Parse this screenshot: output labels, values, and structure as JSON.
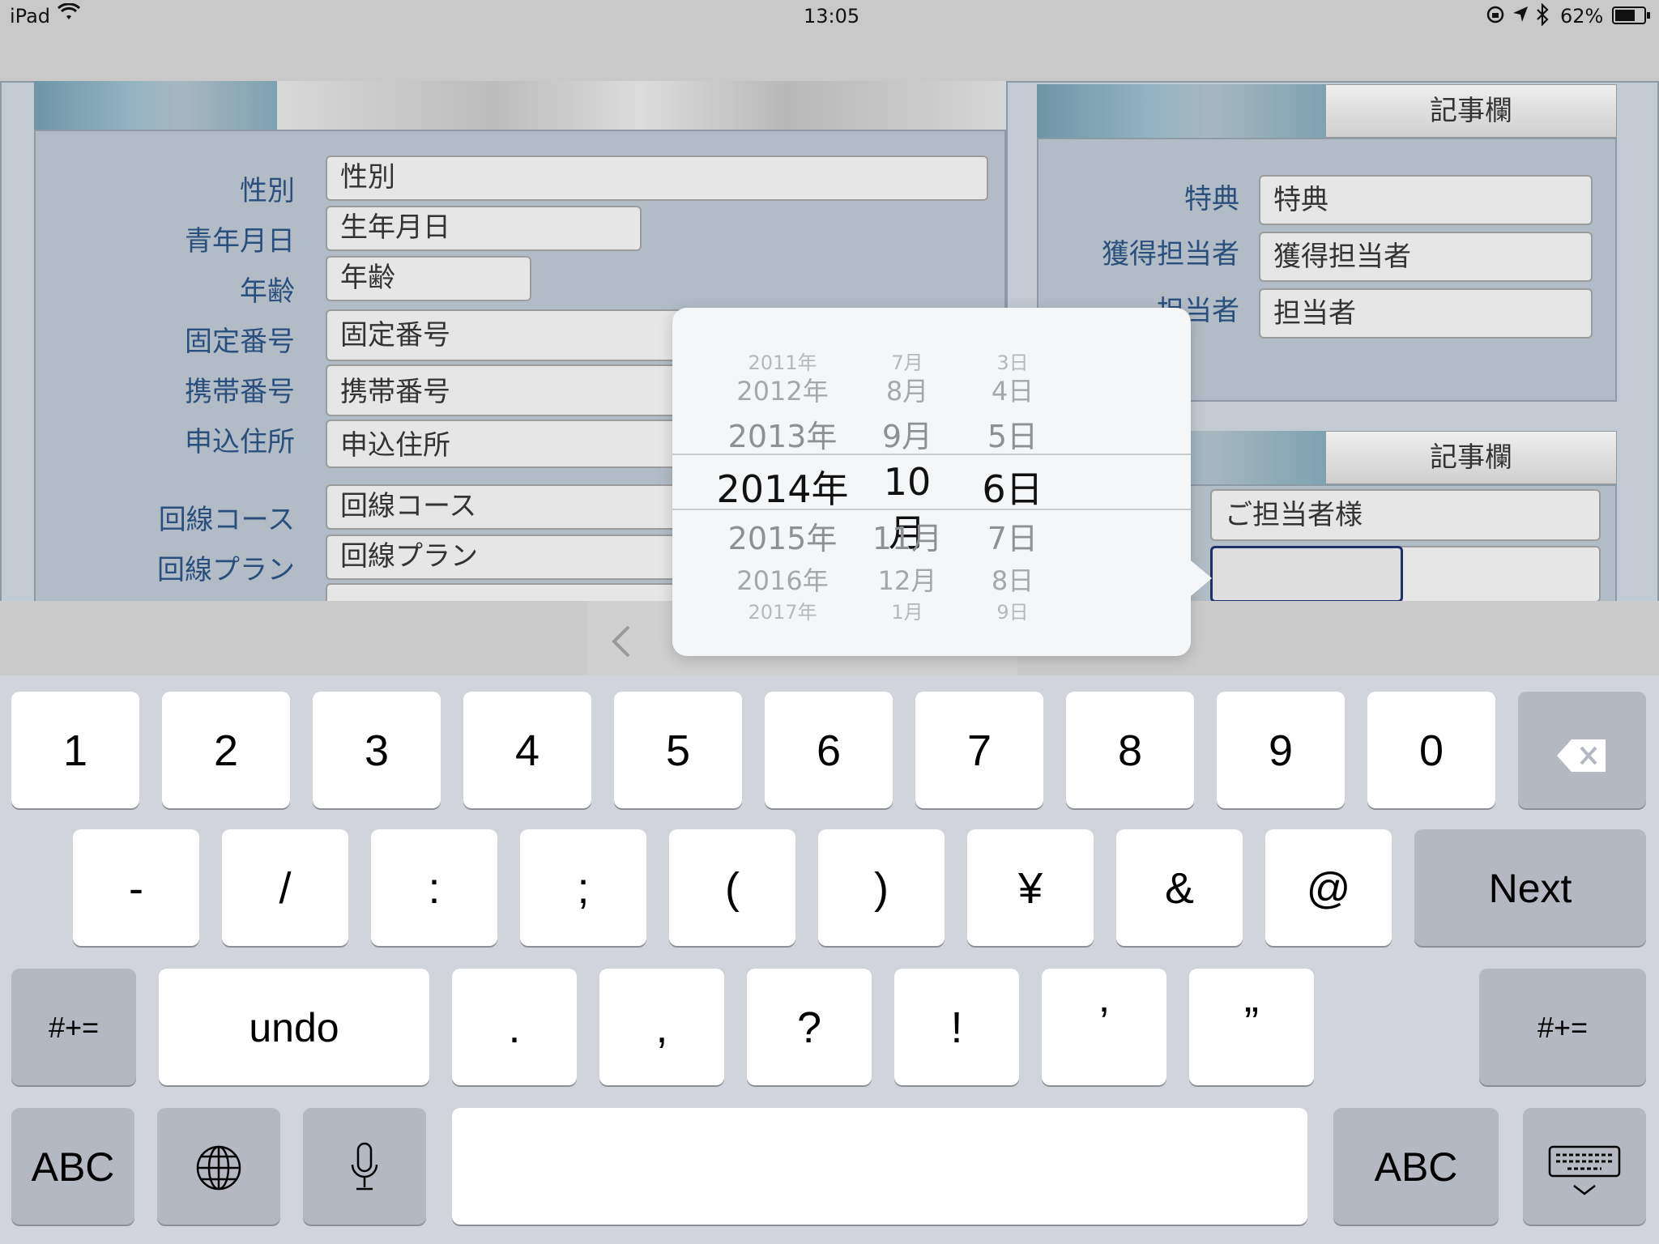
{
  "status_bar": {
    "device": "iPad",
    "time": "13:05",
    "battery": "62%"
  },
  "form_left": {
    "fields": [
      {
        "label": "性別",
        "value": "性別"
      },
      {
        "label": "青年月日",
        "value": "生年月日"
      },
      {
        "label": "年齢",
        "value": "年齢"
      },
      {
        "label": "固定番号",
        "value": "固定番号"
      },
      {
        "label": "携帯番号",
        "value": "携帯番号"
      },
      {
        "label": "申込住所",
        "value": "申込住所"
      },
      {
        "label": "回線コース",
        "value": "回線コース"
      },
      {
        "label": "回線プラン",
        "value": "回線プラン"
      }
    ]
  },
  "form_right": {
    "tab_label": "記事欄",
    "fields": [
      {
        "label": "特典",
        "value": "特典"
      },
      {
        "label": "獲得担当者",
        "value": "獲得担当者"
      },
      {
        "label": "担当者",
        "value": "担当者"
      }
    ],
    "tab_label_2": "記事欄",
    "contact_value": "ご担当者様"
  },
  "date_picker": {
    "rows": [
      {
        "year": "2011年",
        "month": "7月",
        "day": "3日"
      },
      {
        "year": "2012年",
        "month": "8月",
        "day": "4日"
      },
      {
        "year": "2013年",
        "month": "9月",
        "day": "5日"
      },
      {
        "year": "2014年",
        "month": "10月",
        "day": "6日"
      },
      {
        "year": "2015年",
        "month": "11月",
        "day": "7日"
      },
      {
        "year": "2016年",
        "month": "12月",
        "day": "8日"
      },
      {
        "year": "2017年",
        "month": "1月",
        "day": "9日"
      }
    ],
    "selected": {
      "year": "2014年",
      "month": "10月",
      "day": "6日"
    }
  },
  "keyboard": {
    "row1": [
      "1",
      "2",
      "3",
      "4",
      "5",
      "6",
      "7",
      "8",
      "9",
      "0"
    ],
    "row2": [
      "-",
      "/",
      ":",
      ";",
      "(",
      ")",
      "¥",
      "&",
      "@"
    ],
    "next": "Next",
    "row3_left": "#+=",
    "undo": "undo",
    "row3": [
      ".",
      ",",
      "?",
      "!",
      "’",
      "”"
    ],
    "row3_right": "#+=",
    "abc_left": "ABC",
    "abc_right": "ABC"
  }
}
